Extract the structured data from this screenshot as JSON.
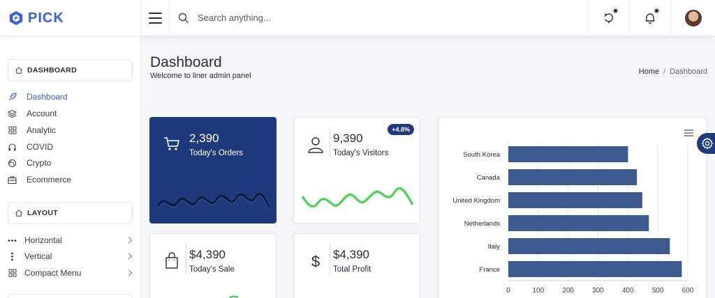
{
  "header": {
    "brand": "PICK",
    "search_placeholder": "Search anything...",
    "icons": [
      "brand-logo-icon",
      "menu-icon",
      "search-icon",
      "sync-icon",
      "bell-icon",
      "avatar"
    ]
  },
  "sidebar": {
    "section_dashboard": "DASHBOARD",
    "dashboard_items": [
      {
        "label": "Dashboard",
        "icon": "rocket-icon",
        "active": true
      },
      {
        "label": "Account",
        "icon": "layers-icon"
      },
      {
        "label": "Analytic",
        "icon": "grid-icon"
      },
      {
        "label": "COVID",
        "icon": "headphones-icon"
      },
      {
        "label": "Crypto",
        "icon": "globe-icon"
      },
      {
        "label": "Ecommerce",
        "icon": "briefcase-icon"
      }
    ],
    "section_layout": "LAYOUT",
    "layout_items": [
      {
        "label": "Horizontal",
        "icon": "dots-horizontal-icon"
      },
      {
        "label": "Vertical",
        "icon": "dots-vertical-icon"
      },
      {
        "label": "Compact Menu",
        "icon": "grid-icon"
      }
    ]
  },
  "main": {
    "title": "Dashboard",
    "subtitle": "Welcome to liner admin panel",
    "breadcrumb": {
      "home": "Home",
      "separator": "/",
      "current": "Dashboard"
    }
  },
  "cards": {
    "orders": {
      "value": "2,390",
      "label": "Today's Orders",
      "icon": "cart-icon"
    },
    "visitors": {
      "value": "9,390",
      "label": "Today's Visitors",
      "badge": "+4.8%",
      "icon": "user-icon"
    },
    "sale": {
      "value": "$4,390",
      "label": "Today's Sale",
      "icon": "shopping-bag-icon"
    },
    "profit": {
      "value": "$4,390",
      "label": "Total Profit",
      "icon": "dollar-icon"
    }
  },
  "colors": {
    "primary": "#1e3a7b",
    "accent": "#3b63d6",
    "bar": "#3d5a8f",
    "spark_green": "#3cc34a"
  },
  "chart_data": {
    "type": "bar",
    "orientation": "horizontal",
    "categories": [
      "South Korea",
      "Canada",
      "United Kingdom",
      "Netherlands",
      "Italy",
      "France"
    ],
    "values": [
      400,
      430,
      448,
      470,
      540,
      580
    ],
    "xlim": [
      0,
      600
    ],
    "xticks": [
      0,
      100,
      200,
      300,
      400,
      500,
      600
    ],
    "grid": true
  }
}
